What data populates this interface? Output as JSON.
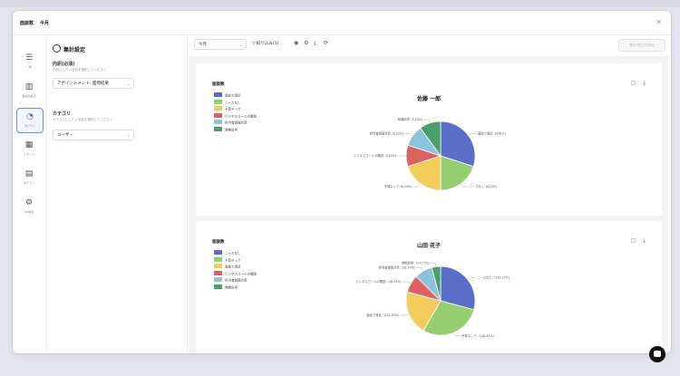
{
  "window": {
    "title": "面談数",
    "subtitle": "今月"
  },
  "rail": [
    {
      "icon": "list-icon",
      "label": "一覧"
    },
    {
      "icon": "bar-chart-icon",
      "label": "面談実績表"
    },
    {
      "icon": "pie-chart-icon",
      "label": "円グラフ"
    },
    {
      "icon": "table-icon",
      "label": "ピボット"
    },
    {
      "icon": "line-chart-icon",
      "label": "棒グラフ"
    },
    {
      "icon": "gear-icon",
      "label": "KPI設定"
    }
  ],
  "settings": {
    "title": "集計設定",
    "breakdown_label": "内訳(必須)",
    "breakdown_hint": "内訳にしたい項目を選択してください",
    "breakdown_value": "アポイントメント: 面問結果",
    "category_label": "カテゴリ",
    "category_hint": "カテゴリにしたい項目を選択してください",
    "category_value": "ユーザー"
  },
  "toolbar": {
    "period": "今月",
    "filter_label": "絞り込み(1)",
    "right_button": "集計項目を保存"
  },
  "colors": [
    "#5b6ec7",
    "#95cd6f",
    "#f2cd5c",
    "#dd6161",
    "#8cc4dc",
    "#4aa06a"
  ],
  "cards": [
    {
      "title": "面談数",
      "legend": [
        "面談で満足",
        "ニーズなし",
        "予算ネック",
        "ビジネスゴールの確認",
        "担当者価値合意",
        "時期尚早"
      ],
      "chart_data": {
        "type": "pie",
        "title": "佐藤 一郎",
        "slices": [
          {
            "label": "面談で満足",
            "value": 9,
            "percent": "30%",
            "display": "面談で満足: 9(30%)"
          },
          {
            "label": "ニーズなし",
            "value": 6,
            "percent": "20%",
            "display": "ニーズなし: 6(20%)"
          },
          {
            "label": "予算ネック",
            "value": 6,
            "percent": "20%",
            "display": "予算ネック: 6(20%)"
          },
          {
            "label": "ビジネスゴールの確認",
            "value": 3,
            "percent": "10%",
            "display": "ビジネスゴールの確認: 3(10%)"
          },
          {
            "label": "担当者価値合意",
            "value": 3,
            "percent": "10%",
            "display": "担当者価値合意: 3(10%)"
          },
          {
            "label": "時期尚早",
            "value": 3,
            "percent": "10%",
            "display": "時期尚早: 3(10%)"
          }
        ]
      }
    },
    {
      "title": "面談数",
      "legend": [
        "ニーズなし",
        "予算ネック",
        "面談で満足",
        "ビジネスゴールの確認",
        "担当者価値合意",
        "時期尚早"
      ],
      "chart_data": {
        "type": "pie",
        "title": "山田 花子",
        "slices": [
          {
            "label": "ニーズなし",
            "value": 7,
            "percent": "29.17%",
            "display": "ニーズなし: 7(29.17%)"
          },
          {
            "label": "予算ネック",
            "value": 7,
            "percent": "29.17%",
            "display": "予算ネック: 7(29.17%)"
          },
          {
            "label": "面談で満足",
            "value": 5,
            "percent": "20.83%",
            "display": "面談で満足: 5(20.83%)"
          },
          {
            "label": "ビジネスゴールの確認",
            "value": 2,
            "percent": "8.33%",
            "display": "ビジネスゴールの確認: 2(8.33%)"
          },
          {
            "label": "担当者価値合意",
            "value": 2,
            "percent": "8.33%",
            "display": "担当者価値合意: 2(8.33%)"
          },
          {
            "label": "時期尚早",
            "value": 1,
            "percent": "4.17%",
            "display": "時期尚早: 1(4.17%)"
          }
        ]
      }
    }
  ]
}
